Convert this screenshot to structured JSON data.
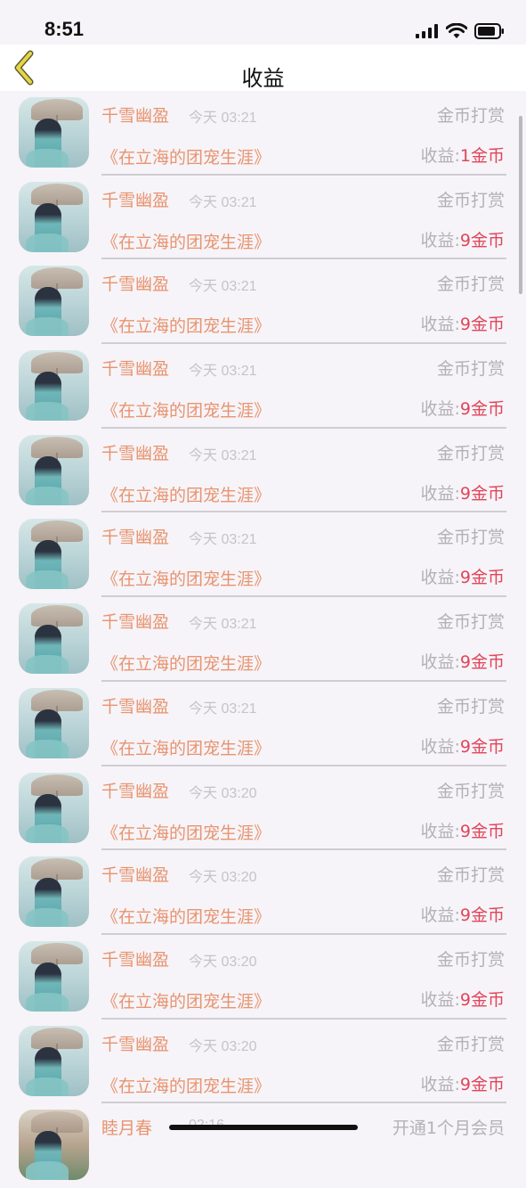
{
  "status": {
    "time": "8:51"
  },
  "nav": {
    "title": "收益"
  },
  "rows": [
    {
      "name": "千雪幽盈",
      "time": "今天 03:21",
      "type": "金币打赏",
      "book": "《在立海的团宠生涯》",
      "income_label": "收益:",
      "income_amount": "1金币"
    },
    {
      "name": "千雪幽盈",
      "time": "今天 03:21",
      "type": "金币打赏",
      "book": "《在立海的团宠生涯》",
      "income_label": "收益:",
      "income_amount": "9金币"
    },
    {
      "name": "千雪幽盈",
      "time": "今天 03:21",
      "type": "金币打赏",
      "book": "《在立海的团宠生涯》",
      "income_label": "收益:",
      "income_amount": "9金币"
    },
    {
      "name": "千雪幽盈",
      "time": "今天 03:21",
      "type": "金币打赏",
      "book": "《在立海的团宠生涯》",
      "income_label": "收益:",
      "income_amount": "9金币"
    },
    {
      "name": "千雪幽盈",
      "time": "今天 03:21",
      "type": "金币打赏",
      "book": "《在立海的团宠生涯》",
      "income_label": "收益:",
      "income_amount": "9金币"
    },
    {
      "name": "千雪幽盈",
      "time": "今天 03:21",
      "type": "金币打赏",
      "book": "《在立海的团宠生涯》",
      "income_label": "收益:",
      "income_amount": "9金币"
    },
    {
      "name": "千雪幽盈",
      "time": "今天 03:21",
      "type": "金币打赏",
      "book": "《在立海的团宠生涯》",
      "income_label": "收益:",
      "income_amount": "9金币"
    },
    {
      "name": "千雪幽盈",
      "time": "今天 03:21",
      "type": "金币打赏",
      "book": "《在立海的团宠生涯》",
      "income_label": "收益:",
      "income_amount": "9金币"
    },
    {
      "name": "千雪幽盈",
      "time": "今天 03:20",
      "type": "金币打赏",
      "book": "《在立海的团宠生涯》",
      "income_label": "收益:",
      "income_amount": "9金币"
    },
    {
      "name": "千雪幽盈",
      "time": "今天 03:20",
      "type": "金币打赏",
      "book": "《在立海的团宠生涯》",
      "income_label": "收益:",
      "income_amount": "9金币"
    },
    {
      "name": "千雪幽盈",
      "time": "今天 03:20",
      "type": "金币打赏",
      "book": "《在立海的团宠生涯》",
      "income_label": "收益:",
      "income_amount": "9金币"
    },
    {
      "name": "千雪幽盈",
      "time": "今天 03:20",
      "type": "金币打赏",
      "book": "《在立海的团宠生涯》",
      "income_label": "收益:",
      "income_amount": "9金币"
    },
    {
      "name": "睦月春",
      "time": "02:16",
      "type": "开通1个月会员",
      "book": "",
      "income_label": "",
      "income_amount": ""
    }
  ],
  "colors": {
    "accent_orange": "#e8936f",
    "amount_red": "#e0455a",
    "back_arrow": "#e6d44a"
  }
}
